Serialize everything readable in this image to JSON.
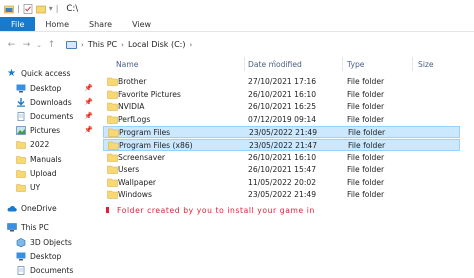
{
  "window": {
    "title": "C:\\"
  },
  "ribbon": {
    "tabs": [
      "File",
      "Home",
      "Share",
      "View"
    ]
  },
  "address": {
    "this_pc": "This PC",
    "local_disk": "Local Disk (C:)"
  },
  "nav": {
    "quick_access": "Quick access",
    "quick_items": [
      "Desktop",
      "Downloads",
      "Documents",
      "Pictures",
      "2022",
      "Manuals",
      "Upload",
      "UY"
    ],
    "onedrive": "OneDrive",
    "this_pc": "This PC",
    "pc_items": [
      "3D Objects",
      "Desktop",
      "Documents"
    ]
  },
  "columns": {
    "name": "Name",
    "date": "Date modified",
    "type": "Type",
    "size": "Size"
  },
  "files": [
    {
      "name": "Brother",
      "date": "27/10/2021 17:16",
      "type": "File folder",
      "selected": false
    },
    {
      "name": "Favorite Pictures",
      "date": "26/10/2021 16:10",
      "type": "File folder",
      "selected": false
    },
    {
      "name": "NVIDIA",
      "date": "26/10/2021 16:25",
      "type": "File folder",
      "selected": false
    },
    {
      "name": "PerfLogs",
      "date": "07/12/2019 09:14",
      "type": "File folder",
      "selected": false
    },
    {
      "name": "Program Files",
      "date": "23/05/2022 21:49",
      "type": "File folder",
      "selected": true
    },
    {
      "name": "Program Files (x86)",
      "date": "23/05/2022 21:47",
      "type": "File folder",
      "selected": true
    },
    {
      "name": "Screensaver",
      "date": "26/10/2021 16:10",
      "type": "File folder",
      "selected": false
    },
    {
      "name": "Users",
      "date": "26/10/2021 15:47",
      "type": "File folder",
      "selected": false
    },
    {
      "name": "Wallpaper",
      "date": "11/05/2022 20:02",
      "type": "File folder",
      "selected": false
    },
    {
      "name": "Windows",
      "date": "23/05/2022 21:49",
      "type": "File folder",
      "selected": false
    }
  ],
  "annotation": "Folder created by you to install your game in",
  "colors": {
    "accent": "#1979ca",
    "selection": "#cce8ff",
    "annotation": "#e0203a",
    "folder": "#f8d775"
  }
}
